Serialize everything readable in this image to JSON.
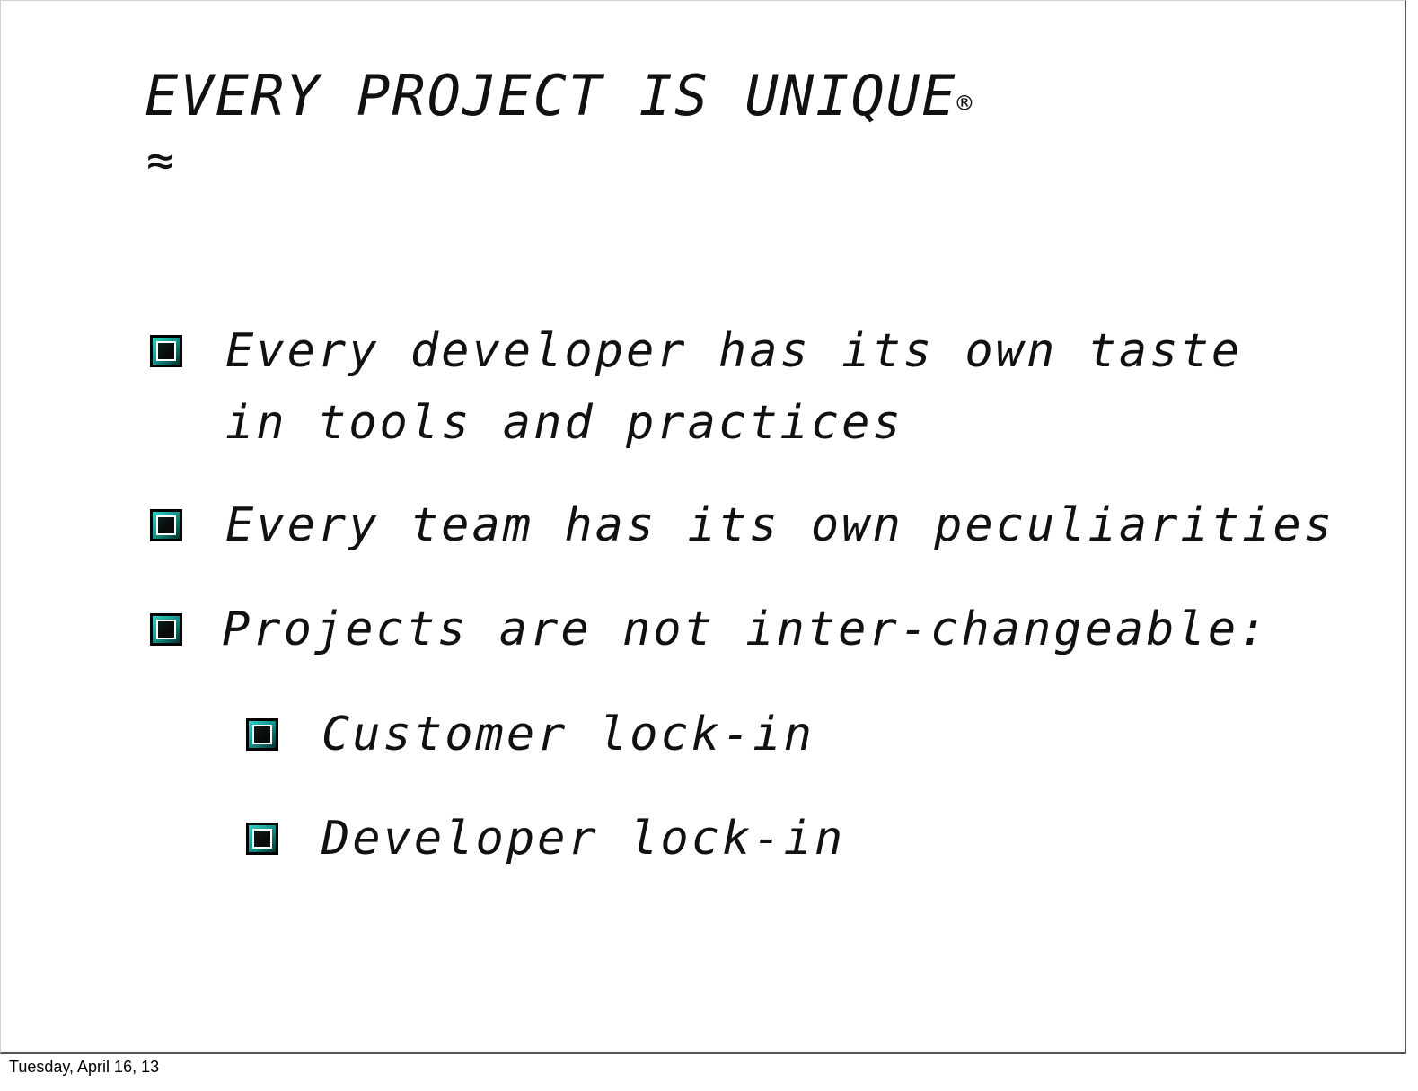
{
  "slide": {
    "title": "EVERY PROJECT IS UNIQUE",
    "title_mark": "®",
    "subtitle": "≈",
    "bullets": [
      {
        "text": "Every developer has its own taste in tools and practices"
      },
      {
        "text": "Every team has its own peculiarities"
      },
      {
        "text": "Projects are not inter-changeable:"
      }
    ],
    "sub_bullets": [
      {
        "text": "Customer lock-in"
      },
      {
        "text": "Developer lock-in"
      }
    ],
    "bullet_icon": "teal-square-bullet-icon",
    "accent_color": "#1fb5a8"
  },
  "footer": {
    "date": "Tuesday, April 16, 13"
  }
}
